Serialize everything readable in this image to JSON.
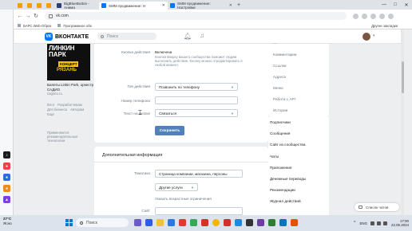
{
  "browser": {
    "tabs": [
      {
        "label": "",
        "favicon_color": "#f2a000"
      },
      {
        "label": "",
        "favicon_color": "#f2a000"
      },
      {
        "label": "",
        "favicon_color": "#f2a000"
      },
      {
        "label": "",
        "favicon_color": "#f2a000"
      },
      {
        "label": "BigBlueButton - Анима",
        "favicon_color": "#2a3f74"
      },
      {
        "label": "SMM продвижение: Н",
        "favicon_color": "#0077ff",
        "active": true
      },
      {
        "label": "SMM продвижение: Настройки",
        "favicon_color": "#0077ff"
      }
    ],
    "new_tab": "+",
    "window_controls": {
      "minimize": "—",
      "maximize": "□",
      "close": "✕"
    },
    "url": "vk.com",
    "bookmarks": [
      "БАРС.Web-Образ",
      "Программное обе"
    ],
    "bookmarks_other": "Другие закладки"
  },
  "vk": {
    "logo_text": "ВКОНТАКТЕ",
    "logo_mark": "VK",
    "search_placeholder": "Поиск"
  },
  "promo": {
    "line1": "ЛИНКИН",
    "line2": "ПАРК",
    "badge": "КОНЦЕРТ",
    "city": "РЯЗАНЬ",
    "ad_title": "Билеты Linkin Park, оркестр САДИО",
    "ad_sub": "cagimo.ru"
  },
  "footer_links": [
    "Блог",
    "Разработчикам",
    "Для бизнеса",
    "Авторам",
    "Ещё"
  ],
  "recommendation_text": "Применяются рекомендательные технологии",
  "settings": {
    "action_button_label": "Кнопка действия",
    "action_button_value": "Включена",
    "action_button_desc": "Кнопка вверху вашего сообщества поможет людям выполнить действие. Кнопку можно отредактировать в любой момент.",
    "action_type_label": "Тип действия",
    "action_type_value": "Позвонить по телефону",
    "phone_label": "Номер телефона",
    "phone_value": "",
    "button_text_label": "Текст на кнопке",
    "button_text_value": "Связаться",
    "save_label": "Сохранить"
  },
  "additional": {
    "title": "Дополнительная информация",
    "subject_label": "Тематика",
    "subject_value": "Страница компании, магазина, персоны",
    "subject_sub_value": "Другие услуги",
    "age_label": "Указать возрастные ограничения",
    "site_label": "Сайт"
  },
  "right_menu": {
    "top_items": [
      "Комментарии",
      "Ссылки",
      "Адреса",
      "Меню",
      "Работа с API",
      "Истории"
    ],
    "items": [
      "Подписчики",
      "Сообщения",
      "Сайт из сообщества",
      "Чаты",
      "Приложения",
      "Денежные переводы",
      "Рекомендации",
      "Журнал действий"
    ]
  },
  "chat_list_label": "Список чатов",
  "taskbar": {
    "weather_temp": "27°C",
    "weather_desc": "Ясно",
    "search_placeholder": "Поиск",
    "lang": "ENG",
    "time": "17:00",
    "date": "22.05.2024"
  }
}
